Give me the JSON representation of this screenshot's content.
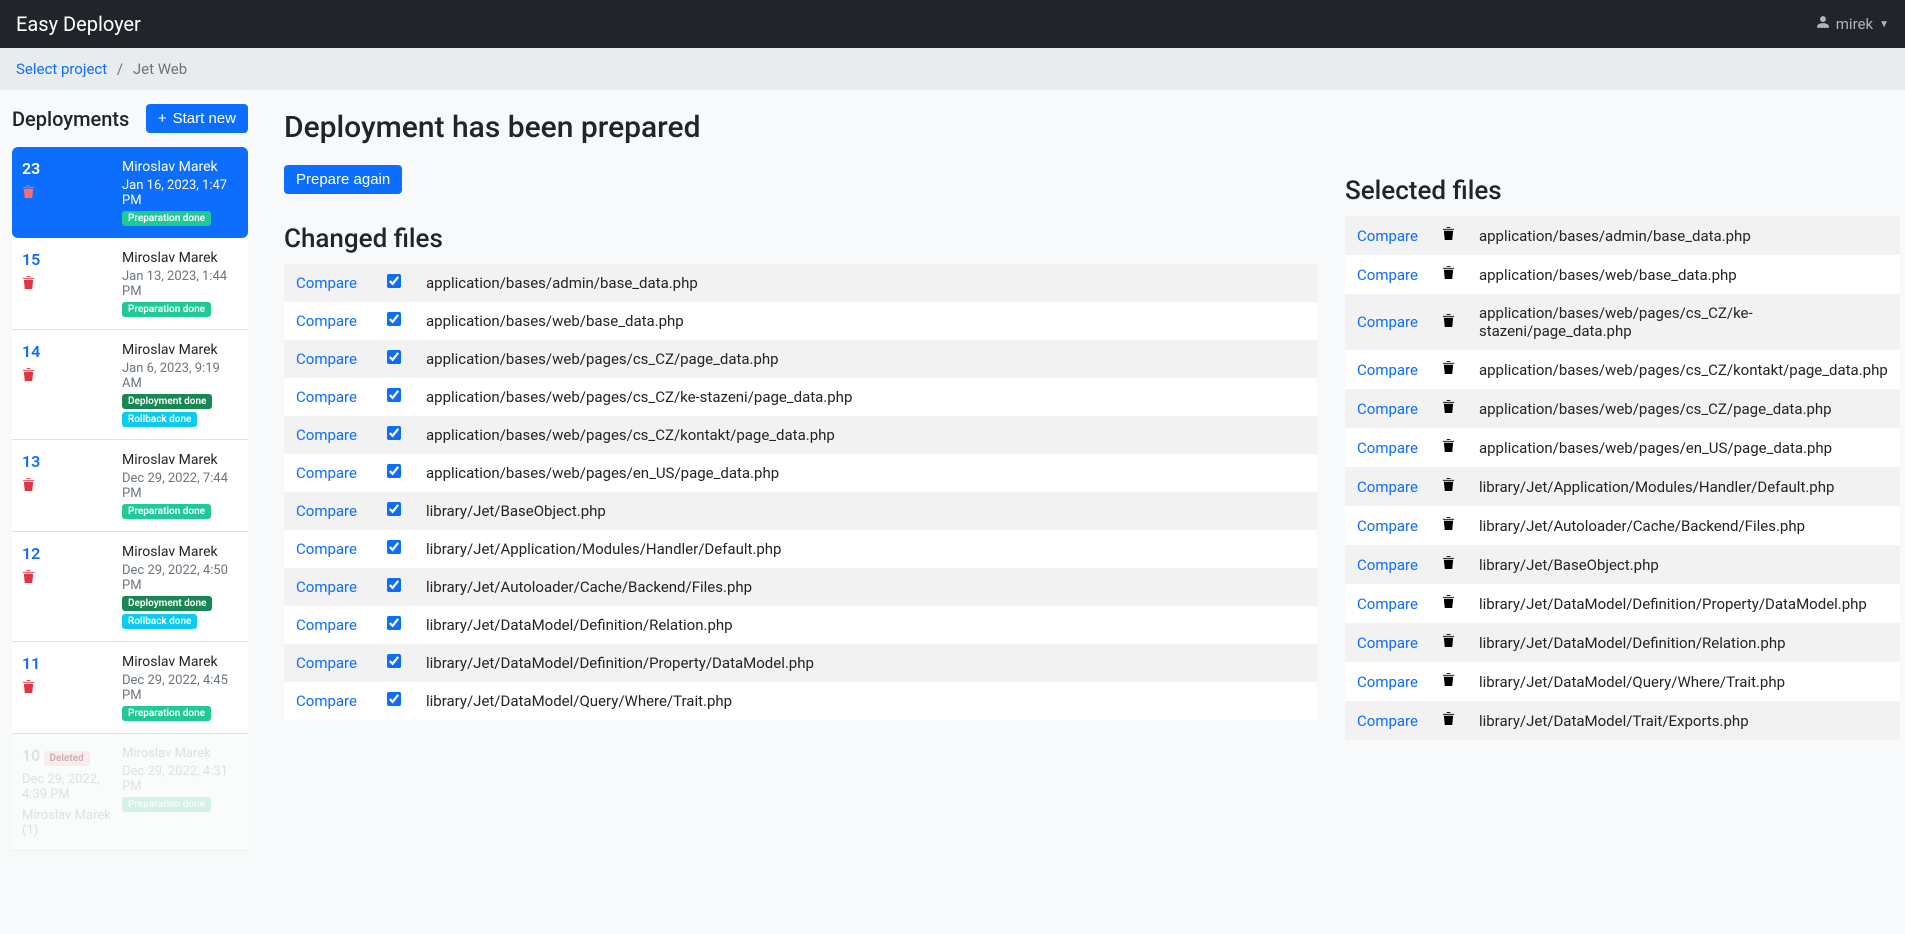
{
  "header": {
    "brand": "Easy Deployer",
    "username": "mirek"
  },
  "breadcrumb": {
    "link": "Select project",
    "current": "Jet Web"
  },
  "sidebar": {
    "title": "Deployments",
    "start_new": "Start new",
    "items": [
      {
        "num": "23",
        "author": "Miroslav Marek",
        "date": "Jan 16, 2023, 1:47 PM",
        "badges": [
          "Preparation done"
        ],
        "active": true
      },
      {
        "num": "15",
        "author": "Miroslav Marek",
        "date": "Jan 13, 2023, 1:44 PM",
        "badges": [
          "Preparation done"
        ]
      },
      {
        "num": "14",
        "author": "Miroslav Marek",
        "date": "Jan 6, 2023, 9:19 AM",
        "badges": [
          "Deployment done",
          "Rollback done"
        ]
      },
      {
        "num": "13",
        "author": "Miroslav Marek",
        "date": "Dec 29, 2022, 7:44 PM",
        "badges": [
          "Preparation done"
        ]
      },
      {
        "num": "12",
        "author": "Miroslav Marek",
        "date": "Dec 29, 2022, 4:50 PM",
        "badges": [
          "Deployment done",
          "Rollback done"
        ]
      },
      {
        "num": "11",
        "author": "Miroslav Marek",
        "date": "Dec 29, 2022, 4:45 PM",
        "badges": [
          "Preparation done"
        ]
      }
    ],
    "faded": {
      "num": "10",
      "deleted": "Deleted",
      "date": "Dec 29, 2022, 4:39 PM",
      "by": "Miroslav Marek (1)",
      "author": "Miroslav Marek",
      "date2": "Dec 29, 2022, 4:31 PM",
      "badge": "Preparation done"
    }
  },
  "main": {
    "title": "Deployment has been prepared",
    "prepare_again": "Prepare again",
    "changed_title": "Changed files",
    "compare": "Compare",
    "changed": [
      "application/bases/admin/base_data.php",
      "application/bases/web/base_data.php",
      "application/bases/web/pages/cs_CZ/page_data.php",
      "application/bases/web/pages/cs_CZ/ke-stazeni/page_data.php",
      "application/bases/web/pages/cs_CZ/kontakt/page_data.php",
      "application/bases/web/pages/en_US/page_data.php",
      "library/Jet/BaseObject.php",
      "library/Jet/Application/Modules/Handler/Default.php",
      "library/Jet/Autoloader/Cache/Backend/Files.php",
      "library/Jet/DataModel/Definition/Relation.php",
      "library/Jet/DataModel/Definition/Property/DataModel.php",
      "library/Jet/DataModel/Query/Where/Trait.php"
    ],
    "selected_title": "Selected files",
    "selected": [
      "application/bases/admin/base_data.php",
      "application/bases/web/base_data.php",
      "application/bases/web/pages/cs_CZ/ke-stazeni/page_data.php",
      "application/bases/web/pages/cs_CZ/kontakt/page_data.php",
      "application/bases/web/pages/cs_CZ/page_data.php",
      "application/bases/web/pages/en_US/page_data.php",
      "library/Jet/Application/Modules/Handler/Default.php",
      "library/Jet/Autoloader/Cache/Backend/Files.php",
      "library/Jet/BaseObject.php",
      "library/Jet/DataModel/Definition/Property/DataModel.php",
      "library/Jet/DataModel/Definition/Relation.php",
      "library/Jet/DataModel/Query/Where/Trait.php",
      "library/Jet/DataModel/Trait/Exports.php"
    ]
  }
}
